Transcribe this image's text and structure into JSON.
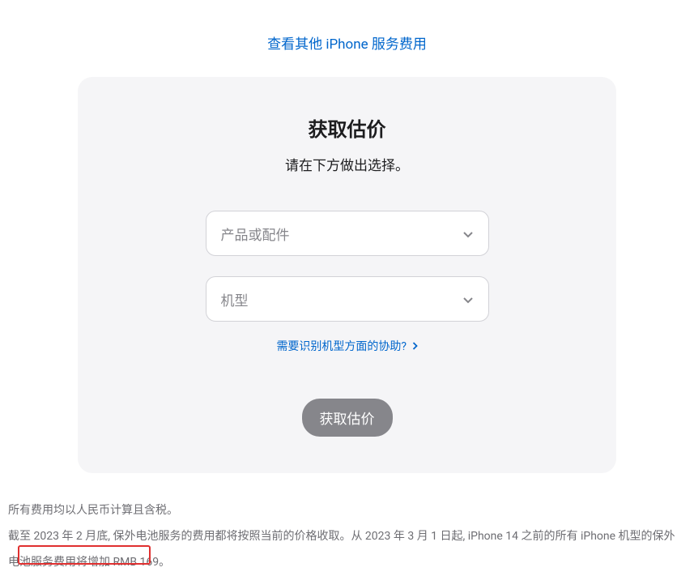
{
  "top_link": {
    "text": "查看其他 iPhone 服务费用"
  },
  "card": {
    "title": "获取估价",
    "subtitle": "请在下方做出选择。",
    "select_product": {
      "placeholder": "产品或配件"
    },
    "select_model": {
      "placeholder": "机型"
    },
    "help_link": {
      "text": "需要识别机型方面的协助?"
    },
    "submit_button": {
      "label": "获取估价"
    }
  },
  "footer": {
    "line1": "所有费用均以人民币计算且含税。",
    "line2": "截至 2023 年 2 月底, 保外电池服务的费用都将按照当前的价格收取。从 2023 年 3 月 1 日起, iPhone 14 之前的所有 iPhone 机型的保外电池服务费用将增加 RMB 169。"
  }
}
